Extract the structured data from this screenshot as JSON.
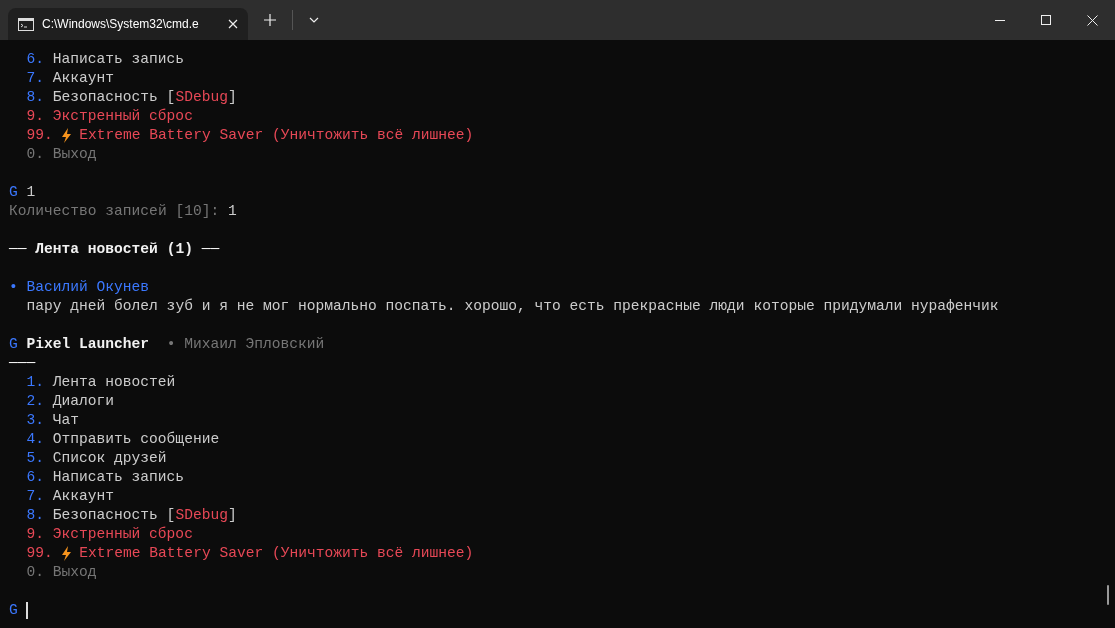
{
  "window": {
    "tab_title": "C:\\Windows\\System32\\cmd.e"
  },
  "terminal": {
    "lines": [
      {
        "kind": "menu",
        "spans": [
          {
            "text": "6.",
            "color": "#3b78ff"
          },
          {
            "text": "Написать запись",
            "color": "#cccccc"
          }
        ]
      },
      {
        "kind": "menu",
        "spans": [
          {
            "text": "7.",
            "color": "#3b78ff"
          },
          {
            "text": "Аккаунт",
            "color": "#cccccc"
          }
        ]
      },
      {
        "kind": "menu",
        "spans": [
          {
            "text": "8.",
            "color": "#3b78ff"
          },
          {
            "text": "Безопасность [",
            "color": "#cccccc"
          },
          {
            "text": "SDebug",
            "color": "#e74856",
            "attached": true
          },
          {
            "text": "]",
            "color": "#cccccc",
            "attached": true
          }
        ]
      },
      {
        "kind": "menu",
        "spans": [
          {
            "text": "9.",
            "color": "#e74856"
          },
          {
            "text": "Экстренный сброс",
            "color": "#e74856"
          }
        ]
      },
      {
        "kind": "menu_bolt",
        "spans": [
          {
            "text": "99.",
            "color": "#e74856"
          },
          {
            "text": "Extreme Battery Saver (Уничтожить всё лишнее)",
            "color": "#e74856"
          }
        ]
      },
      {
        "kind": "menu",
        "spans": [
          {
            "text": "0.",
            "color": "#767676"
          },
          {
            "text": "Выход",
            "color": "#767676"
          }
        ]
      },
      {
        "kind": "blank"
      },
      {
        "kind": "prompt",
        "spans": [
          {
            "text": "G",
            "color": "#3b78ff"
          },
          {
            "text": "1",
            "color": "#cccccc"
          }
        ]
      },
      {
        "kind": "output",
        "spans": [
          {
            "text": "Количество записей [10]:",
            "color": "#767676"
          },
          {
            "text": "1",
            "color": "#cccccc"
          }
        ]
      },
      {
        "kind": "blank"
      },
      {
        "kind": "heading",
        "spans": [
          {
            "text": "── Лента новостей (1) ──",
            "color": "#f2f2f2"
          }
        ]
      },
      {
        "kind": "blank"
      },
      {
        "kind": "author",
        "spans": [
          {
            "text": "• Василий Окунев",
            "color": "#3b78ff"
          }
        ]
      },
      {
        "kind": "post",
        "spans": [
          {
            "text": "пару дней болел зуб и я не мог нормально поспать. хорошо, что есть прекрасные люди которые придумали нурафенчик",
            "color": "#cccccc"
          }
        ]
      },
      {
        "kind": "blank"
      },
      {
        "kind": "prompt",
        "spans": [
          {
            "text": "G",
            "color": "#3b78ff"
          },
          {
            "text": "Pixel Launcher",
            "color": "#f2f2f2"
          },
          {
            "text": "• Михаил Эпловский",
            "color": "#767676",
            "wide": true
          }
        ]
      },
      {
        "kind": "rule",
        "spans": [
          {
            "text": "───",
            "color": "#f2f2f2"
          }
        ]
      },
      {
        "kind": "menu",
        "spans": [
          {
            "text": "1.",
            "color": "#3b78ff"
          },
          {
            "text": "Лента новостей",
            "color": "#cccccc"
          }
        ]
      },
      {
        "kind": "menu",
        "spans": [
          {
            "text": "2.",
            "color": "#3b78ff"
          },
          {
            "text": "Диалоги",
            "color": "#cccccc"
          }
        ]
      },
      {
        "kind": "menu",
        "spans": [
          {
            "text": "3.",
            "color": "#3b78ff"
          },
          {
            "text": "Чат",
            "color": "#cccccc"
          }
        ]
      },
      {
        "kind": "menu",
        "spans": [
          {
            "text": "4.",
            "color": "#3b78ff"
          },
          {
            "text": "Отправить сообщение",
            "color": "#cccccc"
          }
        ]
      },
      {
        "kind": "menu",
        "spans": [
          {
            "text": "5.",
            "color": "#3b78ff"
          },
          {
            "text": "Список друзей",
            "color": "#cccccc"
          }
        ]
      },
      {
        "kind": "menu",
        "spans": [
          {
            "text": "6.",
            "color": "#3b78ff"
          },
          {
            "text": "Написать запись",
            "color": "#cccccc"
          }
        ]
      },
      {
        "kind": "menu",
        "spans": [
          {
            "text": "7.",
            "color": "#3b78ff"
          },
          {
            "text": "Аккаунт",
            "color": "#cccccc"
          }
        ]
      },
      {
        "kind": "menu",
        "spans": [
          {
            "text": "8.",
            "color": "#3b78ff"
          },
          {
            "text": "Безопасность [",
            "color": "#cccccc"
          },
          {
            "text": "SDebug",
            "color": "#e74856",
            "attached": true
          },
          {
            "text": "]",
            "color": "#cccccc",
            "attached": true
          }
        ]
      },
      {
        "kind": "menu",
        "spans": [
          {
            "text": "9.",
            "color": "#e74856"
          },
          {
            "text": "Экстренный сброс",
            "color": "#e74856"
          }
        ]
      },
      {
        "kind": "menu_bolt",
        "spans": [
          {
            "text": "99.",
            "color": "#e74856"
          },
          {
            "text": "Extreme Battery Saver (Уничтожить всё лишнее)",
            "color": "#e74856"
          }
        ]
      },
      {
        "kind": "menu",
        "spans": [
          {
            "text": "0.",
            "color": "#767676"
          },
          {
            "text": "Выход",
            "color": "#767676"
          }
        ]
      },
      {
        "kind": "blank"
      },
      {
        "kind": "prompt",
        "cursor": true,
        "spans": [
          {
            "text": "G",
            "color": "#3b78ff"
          }
        ]
      }
    ]
  }
}
